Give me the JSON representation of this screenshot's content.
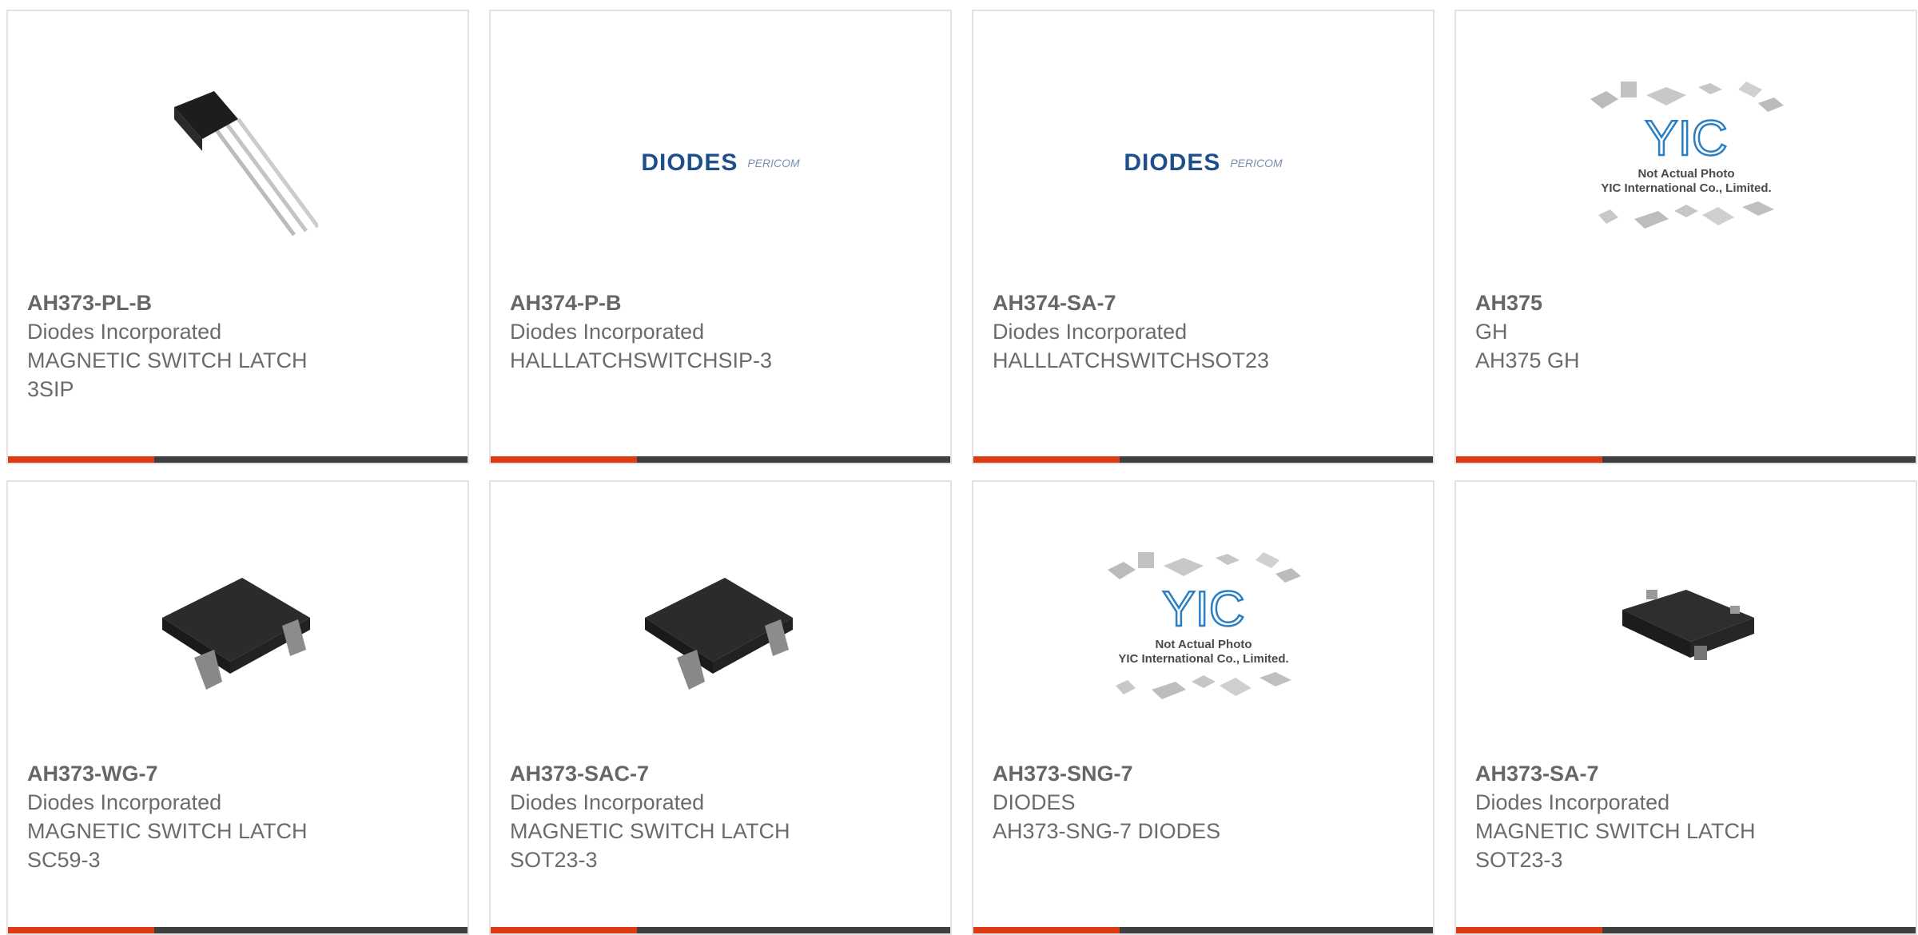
{
  "products": [
    {
      "part": "AH373-PL-B",
      "maker": "Diodes Incorporated",
      "desc1": "MAGNETIC SWITCH LATCH",
      "desc2": "3SIP",
      "image": "to92-3pin-photo"
    },
    {
      "part": "AH374-P-B",
      "maker": "Diodes Incorporated",
      "desc1": "HALLLATCHSWITCHSIP-3",
      "desc2": "",
      "image": "diodes-pericom-logo"
    },
    {
      "part": "AH374-SA-7",
      "maker": "Diodes Incorporated",
      "desc1": "HALLLATCHSWITCHSOT23",
      "desc2": "",
      "image": "diodes-pericom-logo"
    },
    {
      "part": "AH375",
      "maker": "GH",
      "desc1": "AH375 GH",
      "desc2": "",
      "image": "yic-not-actual-photo"
    },
    {
      "part": "AH373-WG-7",
      "maker": "Diodes Incorporated",
      "desc1": "MAGNETIC SWITCH LATCH",
      "desc2": "SC59-3",
      "image": "sot-package-photo"
    },
    {
      "part": "AH373-SAC-7",
      "maker": "Diodes Incorporated",
      "desc1": "MAGNETIC SWITCH LATCH",
      "desc2": "SOT23-3",
      "image": "sot-package-photo"
    },
    {
      "part": "AH373-SNG-7",
      "maker": "DIODES",
      "desc1": "AH373-SNG-7 DIODES",
      "desc2": "",
      "image": "yic-not-actual-photo"
    },
    {
      "part": "AH373-SA-7",
      "maker": "Diodes Incorporated",
      "desc1": "MAGNETIC SWITCH LATCH",
      "desc2": "SOT23-3",
      "image": "sot23-small-photo"
    }
  ],
  "logos": {
    "diodes_text": "DIODES",
    "pericom_text": "PERICOM",
    "yic_mark": "YIC",
    "yic_line1": "Not Actual Photo",
    "yic_line2": "YIC International Co., Limited."
  },
  "colors": {
    "accent": "#e03a12",
    "bar": "#3f3f3f",
    "text": "#6b6b6b"
  }
}
